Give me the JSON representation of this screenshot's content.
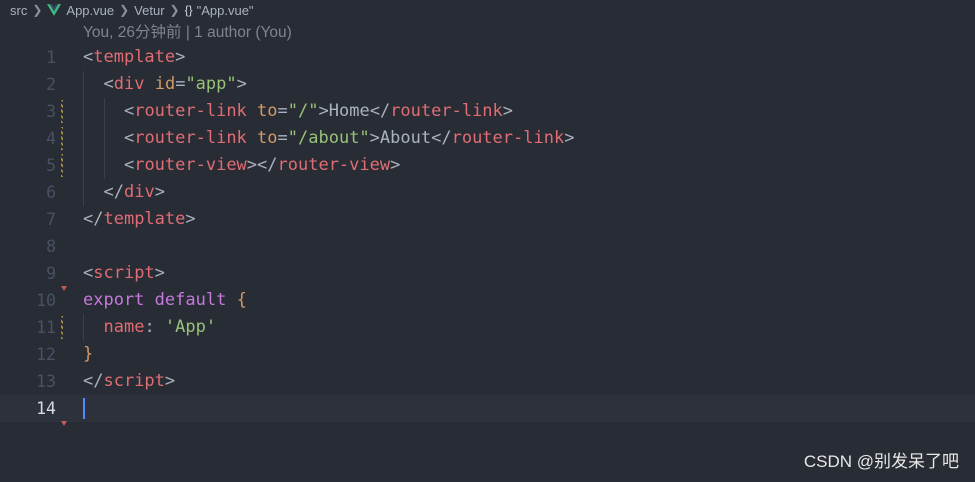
{
  "breadcrumb": {
    "items": [
      "src",
      "App.vue",
      "Vetur",
      "\"App.vue\""
    ]
  },
  "codelens": "You, 26分钟前 | 1 author (You)",
  "colors": {
    "tag": "#e06c75",
    "attr": "#d19a66",
    "string": "#98c379",
    "keyword": "#c678dd",
    "punct": "#abb2bf",
    "background": "#282c34",
    "vue_green": "#41b883"
  },
  "editor": {
    "current_line": 14,
    "lines": [
      {
        "n": "1",
        "tokens": [
          {
            "t": "<",
            "c": "punct"
          },
          {
            "t": "template",
            "c": "tag"
          },
          {
            "t": ">",
            "c": "punct"
          }
        ]
      },
      {
        "n": "2",
        "tokens": [
          {
            "t": "  ",
            "c": "text"
          },
          {
            "t": "<",
            "c": "punct"
          },
          {
            "t": "div",
            "c": "tag"
          },
          {
            "t": " ",
            "c": "text"
          },
          {
            "t": "id",
            "c": "attr"
          },
          {
            "t": "=",
            "c": "punct"
          },
          {
            "t": "\"app\"",
            "c": "str"
          },
          {
            "t": ">",
            "c": "punct"
          }
        ]
      },
      {
        "n": "3",
        "tokens": [
          {
            "t": "    ",
            "c": "text"
          },
          {
            "t": "<",
            "c": "punct"
          },
          {
            "t": "router-link",
            "c": "tag"
          },
          {
            "t": " ",
            "c": "text"
          },
          {
            "t": "to",
            "c": "attr"
          },
          {
            "t": "=",
            "c": "punct"
          },
          {
            "t": "\"/\"",
            "c": "str"
          },
          {
            "t": ">",
            "c": "punct"
          },
          {
            "t": "Home",
            "c": "text"
          },
          {
            "t": "</",
            "c": "punct"
          },
          {
            "t": "router-link",
            "c": "tag"
          },
          {
            "t": ">",
            "c": "punct"
          }
        ]
      },
      {
        "n": "4",
        "tokens": [
          {
            "t": "    ",
            "c": "text"
          },
          {
            "t": "<",
            "c": "punct"
          },
          {
            "t": "router-link",
            "c": "tag"
          },
          {
            "t": " ",
            "c": "text"
          },
          {
            "t": "to",
            "c": "attr"
          },
          {
            "t": "=",
            "c": "punct"
          },
          {
            "t": "\"/about\"",
            "c": "str"
          },
          {
            "t": ">",
            "c": "punct"
          },
          {
            "t": "About",
            "c": "text"
          },
          {
            "t": "</",
            "c": "punct"
          },
          {
            "t": "router-link",
            "c": "tag"
          },
          {
            "t": ">",
            "c": "punct"
          }
        ]
      },
      {
        "n": "5",
        "tokens": [
          {
            "t": "    ",
            "c": "text"
          },
          {
            "t": "<",
            "c": "punct"
          },
          {
            "t": "router-view",
            "c": "tag"
          },
          {
            "t": "></",
            "c": "punct"
          },
          {
            "t": "router-view",
            "c": "tag"
          },
          {
            "t": ">",
            "c": "punct"
          }
        ]
      },
      {
        "n": "6",
        "tokens": [
          {
            "t": "  ",
            "c": "text"
          },
          {
            "t": "</",
            "c": "punct"
          },
          {
            "t": "div",
            "c": "tag"
          },
          {
            "t": ">",
            "c": "punct"
          }
        ]
      },
      {
        "n": "7",
        "tokens": [
          {
            "t": "</",
            "c": "punct"
          },
          {
            "t": "template",
            "c": "tag"
          },
          {
            "t": ">",
            "c": "punct"
          }
        ]
      },
      {
        "n": "8",
        "tokens": []
      },
      {
        "n": "9",
        "tokens": [
          {
            "t": "<",
            "c": "punct"
          },
          {
            "t": "script",
            "c": "tag"
          },
          {
            "t": ">",
            "c": "punct"
          }
        ]
      },
      {
        "n": "10",
        "tokens": [
          {
            "t": "export",
            "c": "kw"
          },
          {
            "t": " ",
            "c": "text"
          },
          {
            "t": "default",
            "c": "kw"
          },
          {
            "t": " ",
            "c": "text"
          },
          {
            "t": "{",
            "c": "brace"
          }
        ]
      },
      {
        "n": "11",
        "tokens": [
          {
            "t": "  ",
            "c": "text"
          },
          {
            "t": "name",
            "c": "prop"
          },
          {
            "t": ": ",
            "c": "punct"
          },
          {
            "t": "'App'",
            "c": "str"
          }
        ]
      },
      {
        "n": "12",
        "tokens": [
          {
            "t": "}",
            "c": "brace"
          }
        ]
      },
      {
        "n": "13",
        "tokens": [
          {
            "t": "</",
            "c": "punct"
          },
          {
            "t": "script",
            "c": "tag"
          },
          {
            "t": ">",
            "c": "punct"
          }
        ]
      },
      {
        "n": "14",
        "tokens": []
      }
    ]
  },
  "watermark": "CSDN @别发呆了吧"
}
